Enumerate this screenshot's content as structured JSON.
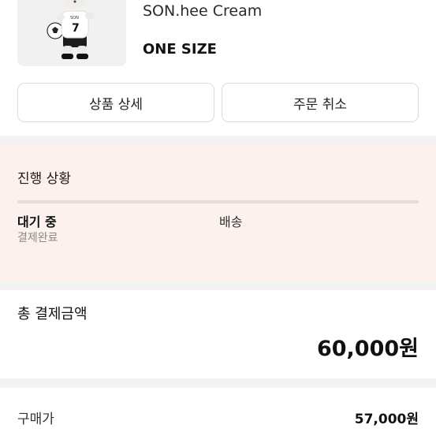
{
  "product": {
    "name": "SON.hee Cream",
    "option": "ONE SIZE",
    "image_jersey_text": "SON",
    "image_jersey_number": "7"
  },
  "actions": {
    "detail_label": "상품 상세",
    "cancel_label": "주문 취소"
  },
  "status": {
    "title": "진행 상황",
    "steps": [
      {
        "label": "대기 중",
        "sub": "결제완료"
      },
      {
        "label": "배송"
      }
    ]
  },
  "payment": {
    "total_label": "총 결제금액",
    "total_amount": "60,000원",
    "lines": [
      {
        "label": "구매가",
        "value": "57,000원"
      }
    ]
  },
  "colors": {
    "status_bg": "#fdf1ee",
    "gap_bg": "#f3f3f3"
  }
}
